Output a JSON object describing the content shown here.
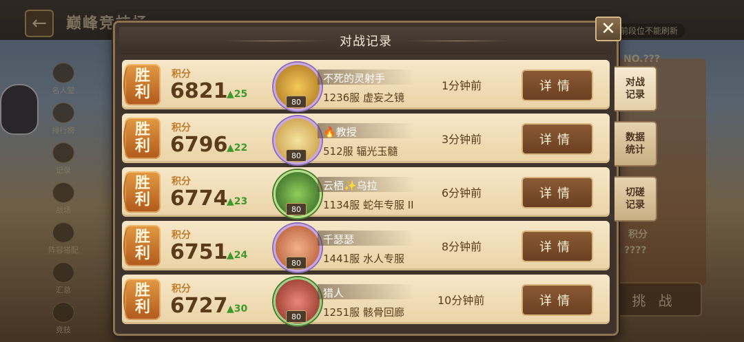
{
  "background": {
    "title": "巅峰竞技场",
    "notice": "前段位不能刷新",
    "nav": [
      "名人堂",
      "排行榜",
      "记录",
      "战场",
      "阵容搭配",
      "汇总",
      "竞技"
    ],
    "right_label_1": "NO.???",
    "right_label_2": "积分",
    "right_label_3": "????",
    "challenge_label": "挑 战"
  },
  "modal": {
    "title": "对战记录",
    "close_symbol": "✕"
  },
  "records": [
    {
      "result_top": "胜",
      "result_bottom": "利",
      "score_label": "积分",
      "score": "6821",
      "delta": "25",
      "level": "80",
      "name": "不死的灵射手",
      "server": "1236服  虚妄之镜",
      "time": "1分钟前",
      "detail": "详情",
      "avatar_color": "#e3a33a"
    },
    {
      "result_top": "胜",
      "result_bottom": "利",
      "score_label": "积分",
      "score": "6796",
      "delta": "22",
      "level": "80",
      "name": "🔥教授",
      "server": "512服  辐光玉髓",
      "time": "3分钟前",
      "detail": "详情",
      "avatar_color": "#e8c86a"
    },
    {
      "result_top": "胜",
      "result_bottom": "利",
      "score_label": "积分",
      "score": "6774",
      "delta": "23",
      "level": "80",
      "name": "云栖✨乌拉",
      "server": "1134服  蛇年专服 II",
      "time": "6分钟前",
      "detail": "详情",
      "avatar_color": "#4f8a3a"
    },
    {
      "result_top": "胜",
      "result_bottom": "利",
      "score_label": "积分",
      "score": "6751",
      "delta": "24",
      "level": "80",
      "name": "千瑟瑟",
      "server": "1441服  水人专服",
      "time": "8分钟前",
      "detail": "详情",
      "avatar_color": "#d98a5a"
    },
    {
      "result_top": "胜",
      "result_bottom": "利",
      "score_label": "积分",
      "score": "6727",
      "delta": "30",
      "level": "80",
      "name": "猎人",
      "server": "1251服  骸骨回廊",
      "time": "10分钟前",
      "detail": "详情",
      "avatar_color": "#c9503a"
    }
  ],
  "side_tabs": [
    {
      "label_1": "对战",
      "label_2": "记录",
      "active": true
    },
    {
      "label_1": "数据",
      "label_2": "统计",
      "active": false
    },
    {
      "label_1": "切磋",
      "label_2": "记录",
      "active": false
    }
  ],
  "icons": {
    "back": "arrow-left-icon",
    "close": "close-icon",
    "up": "arrow-up-icon"
  }
}
